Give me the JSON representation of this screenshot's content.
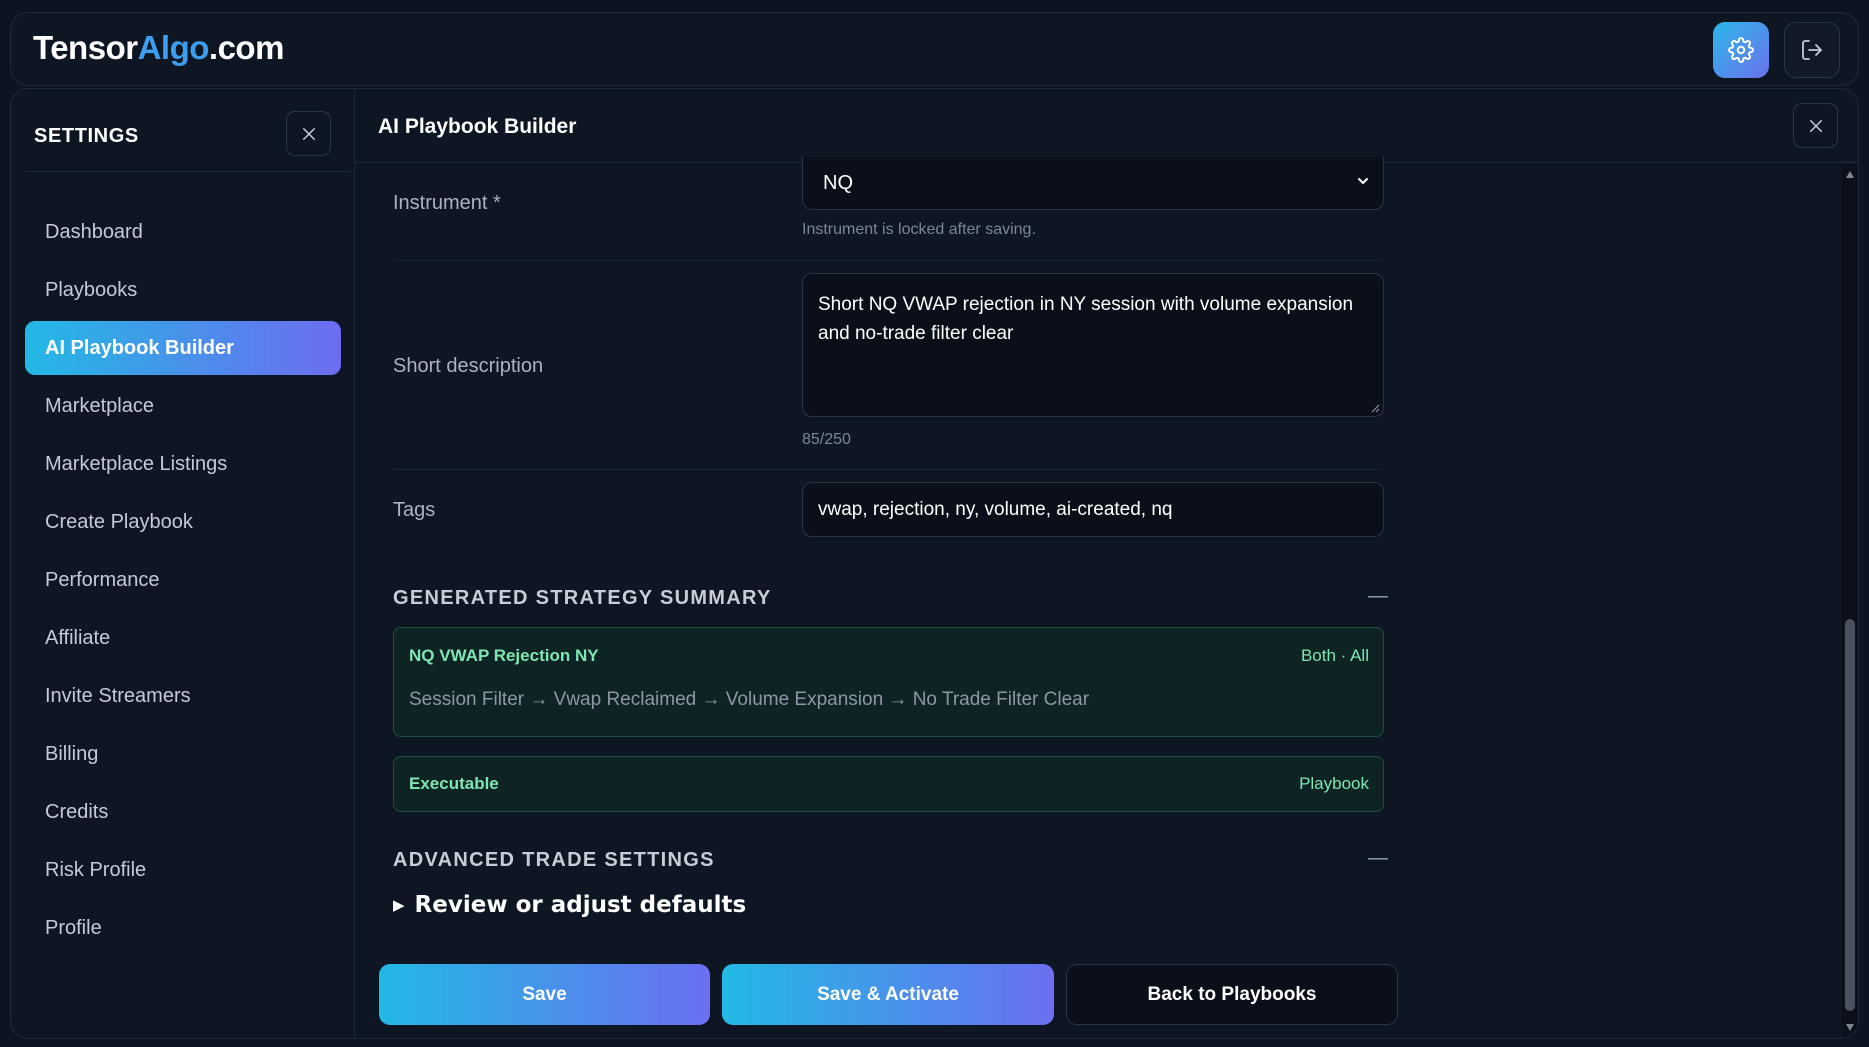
{
  "app": {
    "logo_prefix": "Tensor",
    "logo_accent": "Algo",
    "logo_suffix": ".com"
  },
  "sidebar": {
    "title": "SETTINGS",
    "items": [
      {
        "label": "Dashboard"
      },
      {
        "label": "Playbooks"
      },
      {
        "label": "AI Playbook Builder",
        "active": true
      },
      {
        "label": "Marketplace"
      },
      {
        "label": "Marketplace Listings"
      },
      {
        "label": "Create Playbook"
      },
      {
        "label": "Performance"
      },
      {
        "label": "Affiliate"
      },
      {
        "label": "Invite Streamers"
      },
      {
        "label": "Billing"
      },
      {
        "label": "Credits"
      },
      {
        "label": "Risk Profile"
      },
      {
        "label": "Profile"
      }
    ]
  },
  "main": {
    "title": "AI Playbook Builder",
    "instrument": {
      "label": "Instrument *",
      "value": "NQ",
      "hint": "Instrument is locked after saving."
    },
    "description": {
      "label": "Short description",
      "value": "Short NQ VWAP rejection in NY session with volume expansion and no-trade filter clear",
      "counter": "85/250"
    },
    "tags": {
      "label": "Tags",
      "value": "vwap, rejection, ny, volume, ai-created, nq"
    },
    "summary": {
      "heading": "GENERATED STRATEGY SUMMARY",
      "collapse": "—",
      "strategy_name": "NQ VWAP Rejection NY",
      "strategy_meta": "Both · All",
      "flow": "Session Filter → Vwap Reclaimed → Volume Expansion → No Trade Filter Clear",
      "status_label": "Executable",
      "status_type": "Playbook"
    },
    "advanced": {
      "heading": "ADVANCED TRADE SETTINGS",
      "collapse": "—",
      "toggle": "Review or adjust defaults"
    },
    "buttons": {
      "save": "Save",
      "save_activate": "Save & Activate",
      "back": "Back to Playbooks"
    }
  },
  "colors": {
    "accent_start": "#22b9e5",
    "accent_end": "#6d6cf0",
    "success_text": "#7fe6b2",
    "background": "#0d1320"
  }
}
